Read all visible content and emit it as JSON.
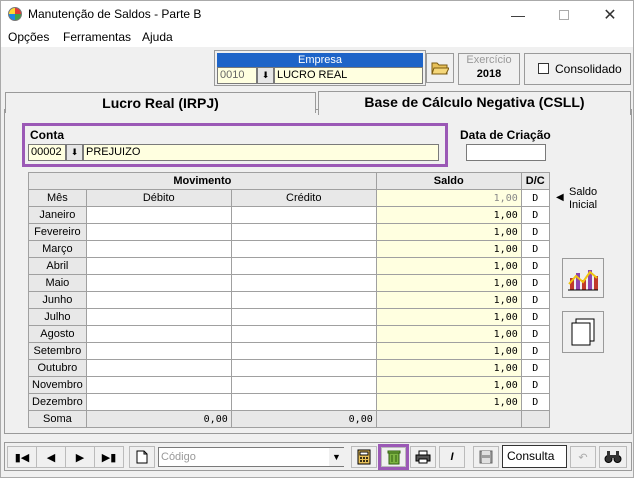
{
  "window": {
    "title": "Manutenção de Saldos - Parte B",
    "min_icon": "minimize-icon",
    "max_icon": "maximize-icon",
    "close_icon": "close-icon"
  },
  "menu": [
    {
      "label": "Opções"
    },
    {
      "label": "Ferramentas"
    },
    {
      "label": "Ajuda"
    }
  ],
  "empresa": {
    "label": "Empresa",
    "code": "0010",
    "name": "LUCRO REAL"
  },
  "exercicio": {
    "label": "Exercício",
    "value": "2018"
  },
  "consolidado": {
    "label": "Consolidado"
  },
  "tabs": [
    {
      "label": "Lucro Real (IRPJ)"
    },
    {
      "label": "Base de Cálculo Negativa (CSLL)"
    }
  ],
  "conta": {
    "label": "Conta",
    "code": "00002",
    "name": "PREJUIZO"
  },
  "data_criacao": {
    "label": "Data de Criação",
    "value": ""
  },
  "grid": {
    "header_movimento": "Movimento",
    "header_saldo": "Saldo",
    "header_dc": "D/C",
    "col_mes": "Mês",
    "col_debito": "Débito",
    "col_credito": "Crédito",
    "saldo_inicial": {
      "value": "1,00",
      "dc": "D"
    },
    "rows": [
      {
        "mes": "Janeiro",
        "debito": "",
        "credito": "",
        "saldo": "1,00",
        "dc": "D"
      },
      {
        "mes": "Fevereiro",
        "debito": "",
        "credito": "",
        "saldo": "1,00",
        "dc": "D"
      },
      {
        "mes": "Março",
        "debito": "",
        "credito": "",
        "saldo": "1,00",
        "dc": "D"
      },
      {
        "mes": "Abril",
        "debito": "",
        "credito": "",
        "saldo": "1,00",
        "dc": "D"
      },
      {
        "mes": "Maio",
        "debito": "",
        "credito": "",
        "saldo": "1,00",
        "dc": "D"
      },
      {
        "mes": "Junho",
        "debito": "",
        "credito": "",
        "saldo": "1,00",
        "dc": "D"
      },
      {
        "mes": "Julho",
        "debito": "",
        "credito": "",
        "saldo": "1,00",
        "dc": "D"
      },
      {
        "mes": "Agosto",
        "debito": "",
        "credito": "",
        "saldo": "1,00",
        "dc": "D"
      },
      {
        "mes": "Setembro",
        "debito": "",
        "credito": "",
        "saldo": "1,00",
        "dc": "D"
      },
      {
        "mes": "Outubro",
        "debito": "",
        "credito": "",
        "saldo": "1,00",
        "dc": "D"
      },
      {
        "mes": "Novembro",
        "debito": "",
        "credito": "",
        "saldo": "1,00",
        "dc": "D"
      },
      {
        "mes": "Dezembro",
        "debito": "",
        "credito": "",
        "saldo": "1,00",
        "dc": "D"
      }
    ],
    "soma": {
      "label": "Soma",
      "debito": "0,00",
      "credito": "0,00"
    }
  },
  "saldo_inicial_label": {
    "line1": "Saldo",
    "line2": "Inicial"
  },
  "toolbar": {
    "codigo_placeholder": "Código",
    "mode": "Consulta"
  },
  "colors": {
    "accent": "#1e64c8",
    "highlight": "#9b59b6",
    "yellow": "#ffffe0"
  }
}
